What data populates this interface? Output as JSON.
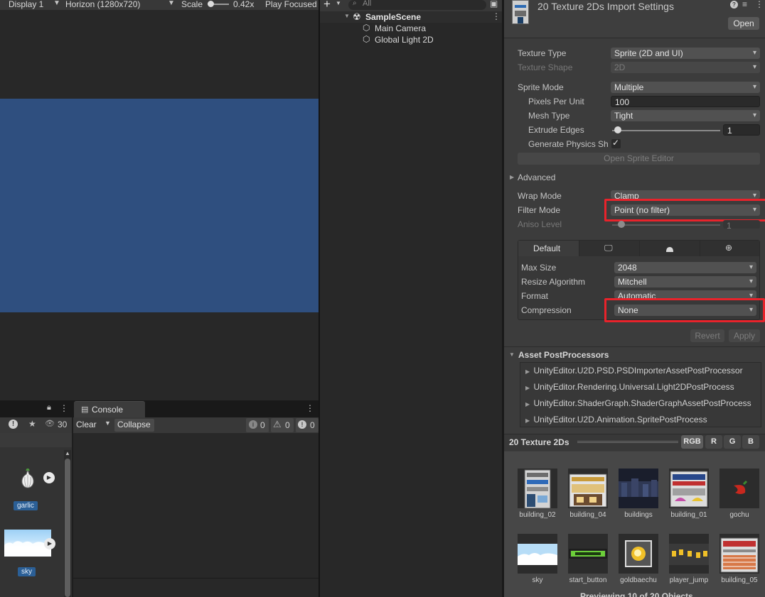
{
  "game_view": {
    "display": "Display 1",
    "resolution": "Horizon (1280x720)",
    "scale_label": "Scale",
    "scale_value": "0.42x",
    "play_focused": "Play Focused",
    "bg_color": "#2f4f7f"
  },
  "project": {
    "hidden_count": "30",
    "assets": [
      {
        "name": "garlic"
      },
      {
        "name": "sky"
      }
    ]
  },
  "console": {
    "tab": "Console",
    "clear": "Clear",
    "collapse": "Collapse",
    "info_count": "0",
    "warn_count": "0",
    "error_count": "0"
  },
  "hierarchy": {
    "search_placeholder": "All",
    "scene": "SampleScene",
    "items": [
      "Main Camera",
      "Global Light 2D"
    ]
  },
  "inspector": {
    "title": "20 Texture 2Ds Import Settings",
    "open_button": "Open",
    "rows": {
      "texture_type": {
        "label": "Texture Type",
        "value": "Sprite (2D and UI)"
      },
      "texture_shape": {
        "label": "Texture Shape",
        "value": "2D"
      },
      "sprite_mode": {
        "label": "Sprite Mode",
        "value": "Multiple"
      },
      "ppu": {
        "label": "Pixels Per Unit",
        "value": "100"
      },
      "mesh_type": {
        "label": "Mesh Type",
        "value": "Tight"
      },
      "extrude": {
        "label": "Extrude Edges",
        "value": "1"
      },
      "gen_physics": {
        "label": "Generate Physics Sh",
        "value": "✓"
      },
      "wrap_mode": {
        "label": "Wrap Mode",
        "value": "Clamp"
      },
      "filter_mode": {
        "label": "Filter Mode",
        "value": "Point (no filter)"
      },
      "aniso": {
        "label": "Aniso Level",
        "value": "1"
      }
    },
    "open_sprite_editor": "Open Sprite Editor",
    "advanced": "Advanced",
    "platform": {
      "default_tab": "Default",
      "max_size": {
        "label": "Max Size",
        "value": "2048"
      },
      "resize": {
        "label": "Resize Algorithm",
        "value": "Mitchell"
      },
      "format": {
        "label": "Format",
        "value": "Automatic"
      },
      "compression": {
        "label": "Compression",
        "value": "None"
      }
    },
    "revert": "Revert",
    "apply": "Apply",
    "postprocessors": {
      "title": "Asset PostProcessors",
      "items": [
        "UnityEditor.U2D.PSD.PSDImporterAssetPostProcessor",
        "UnityEditor.Rendering.Universal.Light2DPostProcess",
        "UnityEditor.ShaderGraph.ShaderGraphAssetPostProcess",
        "UnityEditor.U2D.Animation.SpritePostProcess"
      ]
    }
  },
  "preview": {
    "title": "20 Texture 2Ds",
    "channels": [
      "RGB",
      "R",
      "G",
      "B"
    ],
    "thumbs": [
      "building_02",
      "building_04",
      "buildings",
      "building_01",
      "gochu",
      "sky",
      "start_button",
      "goldbaechu",
      "player_jump",
      "building_05"
    ],
    "footer": "Previewing 10 of 20 Objects"
  }
}
